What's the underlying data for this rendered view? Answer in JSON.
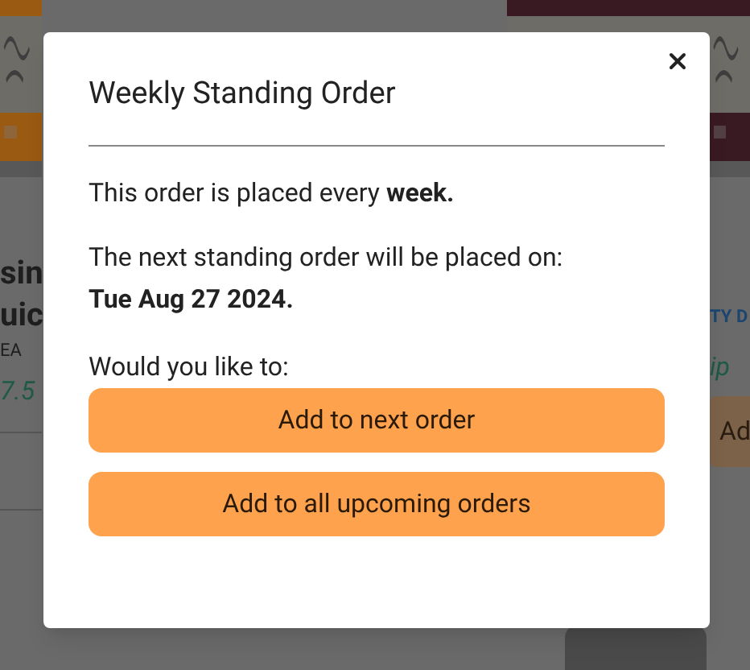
{
  "background": {
    "left_card": {
      "name_lines": [
        "sin",
        "uic"
      ],
      "unit": "EA",
      "price": "7.5"
    },
    "right_card": {
      "badge": "TY D",
      "price": "ip",
      "button": "Ad"
    }
  },
  "dialog": {
    "title": "Weekly Standing Order",
    "frequency": "This order is placed every **week.**",
    "next_order": {
      "label": "The next standing order will be placed on:",
      "date": "Tue Aug 27 2024."
    },
    "prompt": "Would you like to:",
    "buttons": [
      "Add to next order",
      "Add to all upcoming orders"
    ]
  }
}
